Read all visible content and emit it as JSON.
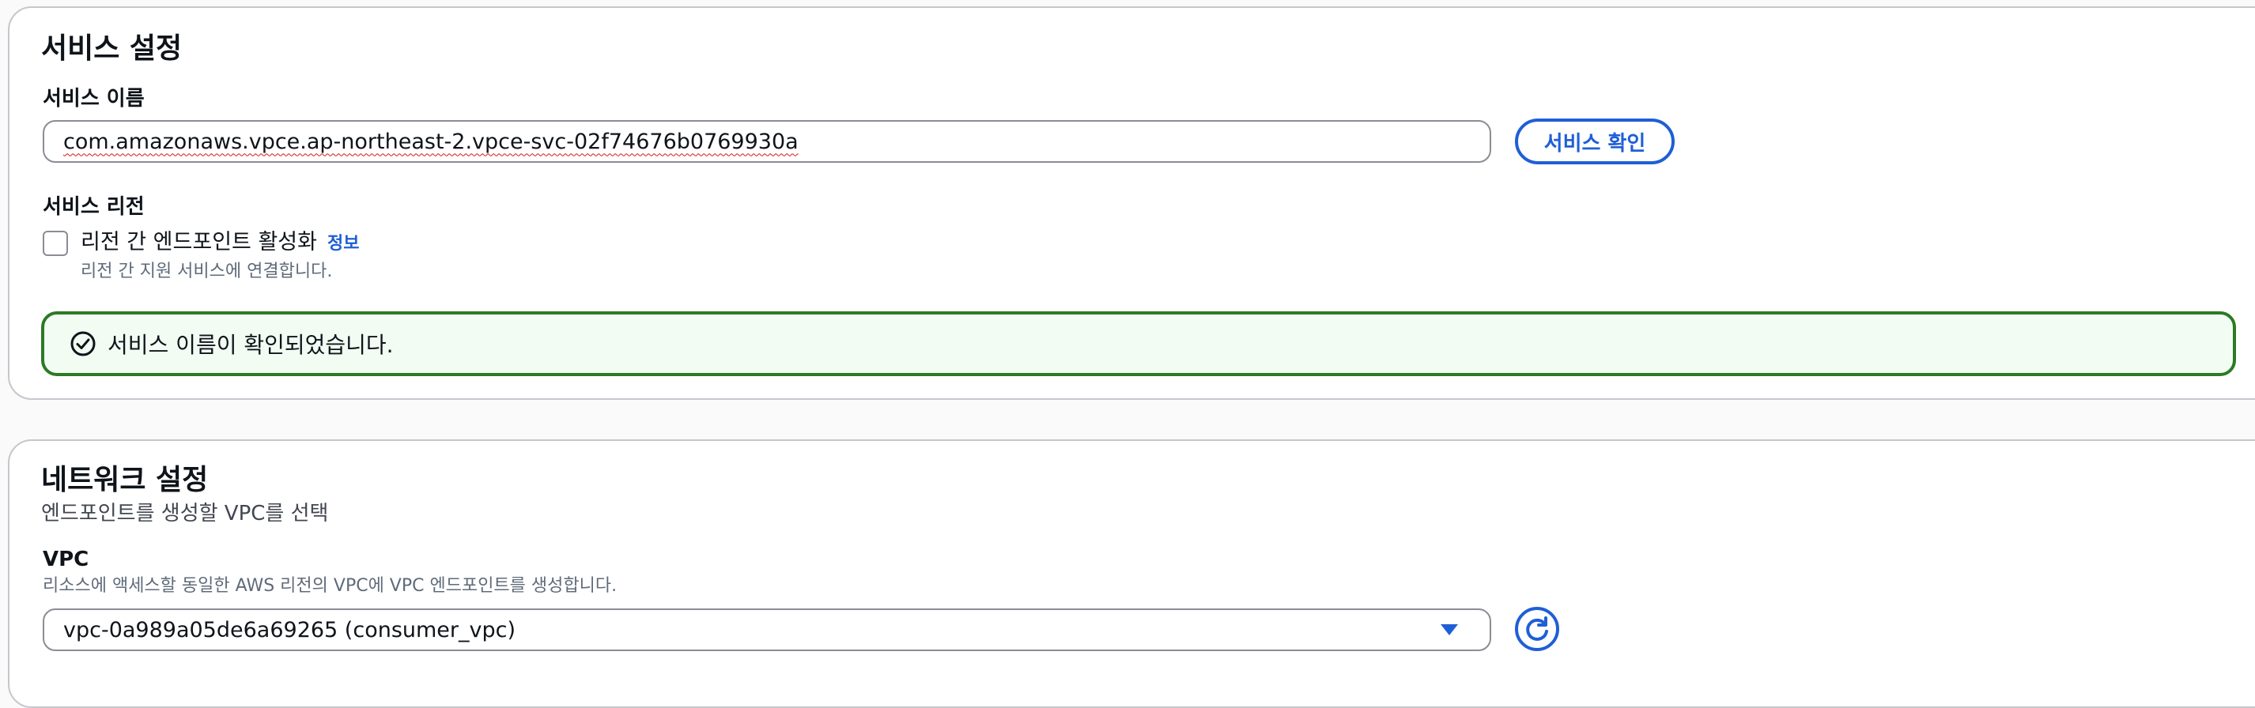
{
  "service_settings": {
    "title": "서비스 설정",
    "name_label": "서비스 이름",
    "name_value": "com.amazonaws.vpce.ap-northeast-2.vpce-svc-02f74676b0769930a",
    "verify_button": "서비스 확인",
    "region_label": "서비스 리전",
    "cross_region_checkbox_label": "리전 간 엔드포인트 활성화",
    "cross_region_checked": false,
    "info_link": "정보",
    "cross_region_description": "리전 간 지원 서비스에 연결합니다.",
    "success_message": "서비스 이름이 확인되었습니다."
  },
  "network_settings": {
    "title": "네트워크 설정",
    "subtitle": "엔드포인트를 생성할 VPC를 선택",
    "vpc_label": "VPC",
    "vpc_description": "리소스에 액세스할 동일한 AWS 리전의 VPC에 VPC 엔드포인트를 생성합니다.",
    "vpc_selected": "vpc-0a989a05de6a69265 (consumer_vpc)"
  },
  "icons": {
    "success": "check-circle-icon",
    "dropdown": "caret-down-icon",
    "refresh": "refresh-icon"
  },
  "colors": {
    "accent": "#1f5fd6",
    "success_border": "#2b7a26",
    "success_background": "#f2fcf3"
  }
}
